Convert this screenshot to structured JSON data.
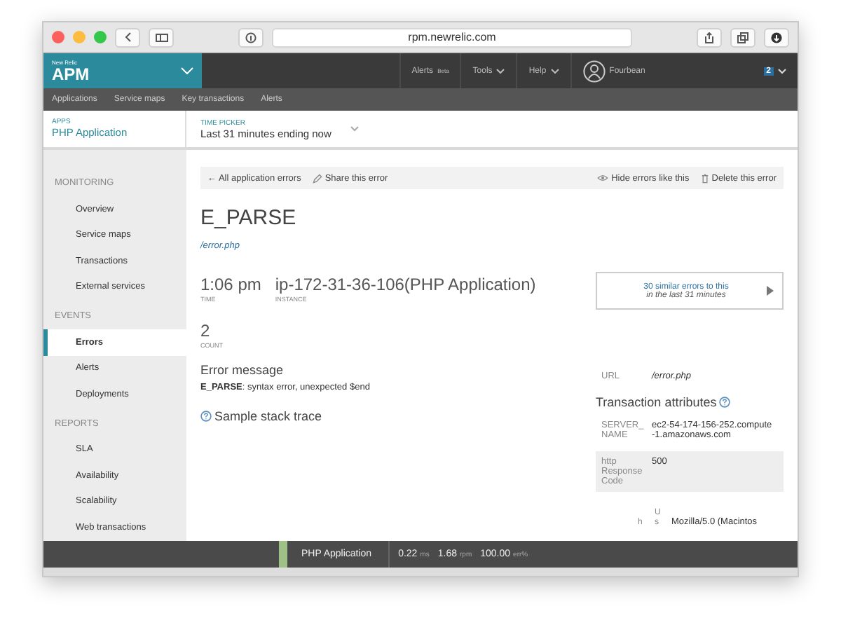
{
  "browser": {
    "url": "rpm.newrelic.com"
  },
  "header": {
    "brand_small": "New Relic",
    "brand": "APM",
    "menus": [
      {
        "label": "Alerts",
        "sup": "Beta",
        "dropdown": false
      },
      {
        "label": "Tools",
        "dropdown": true
      },
      {
        "label": "Help",
        "dropdown": true
      }
    ],
    "user": "Fourbean",
    "badge": "2"
  },
  "subnav": [
    "Applications",
    "Service maps",
    "Key transactions",
    "Alerts"
  ],
  "app_bar": {
    "apps_label": "APPS",
    "app_name": "PHP Application",
    "time_label": "TIME PICKER",
    "time_value": "Last 31 minutes ending now"
  },
  "sidebar": [
    {
      "heading": "MONITORING",
      "items": [
        {
          "label": "Overview",
          "selected": false
        },
        {
          "label": "Service maps",
          "selected": false
        },
        {
          "label": "Transactions",
          "selected": false
        },
        {
          "label": "External services",
          "selected": false
        }
      ]
    },
    {
      "heading": "EVENTS",
      "items": [
        {
          "label": "Errors",
          "selected": true
        },
        {
          "label": "Alerts",
          "selected": false
        },
        {
          "label": "Deployments",
          "selected": false
        }
      ]
    },
    {
      "heading": "REPORTS",
      "items": [
        {
          "label": "SLA",
          "selected": false
        },
        {
          "label": "Availability",
          "selected": false
        },
        {
          "label": "Scalability",
          "selected": false
        },
        {
          "label": "Web transactions",
          "selected": false
        }
      ]
    }
  ],
  "actions": {
    "left": [
      {
        "kind": "back",
        "label": "← All application errors"
      },
      {
        "kind": "share",
        "label": "Share this error"
      }
    ],
    "right": [
      {
        "kind": "hide",
        "label": "Hide errors like this"
      },
      {
        "kind": "delete",
        "label": "Delete this error"
      }
    ]
  },
  "error": {
    "title": "E_PARSE",
    "path": "/error.php",
    "time": "1:06 pm",
    "time_label": "TIME",
    "instance": "ip-172-31-36-106(PHP Application)",
    "instance_label": "INSTANCE",
    "count": "2",
    "count_label": "COUNT"
  },
  "similar": {
    "line1": "30 similar errors to this",
    "line2": "in the last 31 minutes"
  },
  "message": {
    "heading": "Error message",
    "text": "**E_PARSE**: syntax error, unexpected $end"
  },
  "stack_trace": "Sample stack trace",
  "url": {
    "label": "URL",
    "value": "/error.php"
  },
  "attributes": {
    "heading": "Transaction attributes",
    "rows": [
      {
        "name": "SERVER_ NAME",
        "value": "ec2-54-174-156-252.compute -1.amazonaws.com",
        "shaded": false
      },
      {
        "name": "http Response Code",
        "value": "500",
        "shaded": true
      }
    ],
    "partial": {
      "col_1": "h",
      "col_2": "Us",
      "value": "Mozilla/5.0 (Macintos"
    }
  },
  "status_bar": {
    "app": "PHP Application",
    "stats": [
      {
        "value": "0.22",
        "unit": "ms"
      },
      {
        "value": "1.68",
        "unit": "rpm"
      },
      {
        "value": "100.00",
        "unit": "err%"
      }
    ]
  }
}
